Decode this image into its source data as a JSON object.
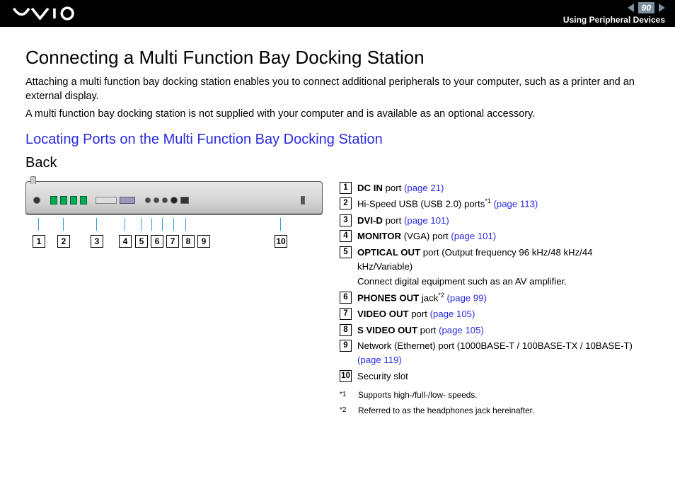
{
  "header": {
    "page_number": "90",
    "section": "Using Peripheral Devices"
  },
  "title": "Connecting a Multi Function Bay Docking Station",
  "intro": {
    "p1": "Attaching a multi function bay docking station enables you to connect additional peripherals to your computer, such as a printer and an external display.",
    "p2": "A multi function bay docking station is not supplied with your computer and is available as an optional accessory."
  },
  "subtitle": "Locating Ports on the Multi Function Bay Docking Station",
  "view_label": "Back",
  "callouts": [
    "1",
    "2",
    "3",
    "4",
    "5",
    "6",
    "7",
    "8",
    "9",
    "10"
  ],
  "legend": [
    {
      "num": "1",
      "bold": "DC IN",
      "rest": " port ",
      "link": "(page 21)"
    },
    {
      "num": "2",
      "bold": "",
      "rest": "Hi-Speed USB (USB 2.0) ports",
      "sup": "*1",
      "link": " (page 113)"
    },
    {
      "num": "3",
      "bold": "DVI-D",
      "rest": " port ",
      "link": "(page 101)"
    },
    {
      "num": "4",
      "bold": "MONITOR",
      "rest": " (VGA) port ",
      "link": "(page 101)"
    },
    {
      "num": "5",
      "bold": "OPTICAL OUT",
      "rest": " port (Output frequency 96 kHz/48 kHz/44 kHz/Variable)",
      "sub": "Connect digital equipment such as an AV amplifier."
    },
    {
      "num": "6",
      "bold": "PHONES OUT",
      "rest": " jack",
      "sup": "*2",
      "link": " (page 99)"
    },
    {
      "num": "7",
      "bold": "VIDEO OUT",
      "rest": " port ",
      "link": "(page 105)"
    },
    {
      "num": "8",
      "bold": "S VIDEO OUT",
      "rest": " port ",
      "link": "(page 105)"
    },
    {
      "num": "9",
      "bold": "",
      "rest": "Network (Ethernet) port (1000BASE-T / 100BASE-TX / 10BASE-T) ",
      "link": "(page 119)"
    },
    {
      "num": "10",
      "bold": "",
      "rest": "Security slot"
    }
  ],
  "footnotes": [
    {
      "mark": "*1",
      "text": "Supports high-/full-/low- speeds."
    },
    {
      "mark": "*2",
      "text": "Referred to as the headphones jack hereinafter."
    }
  ]
}
